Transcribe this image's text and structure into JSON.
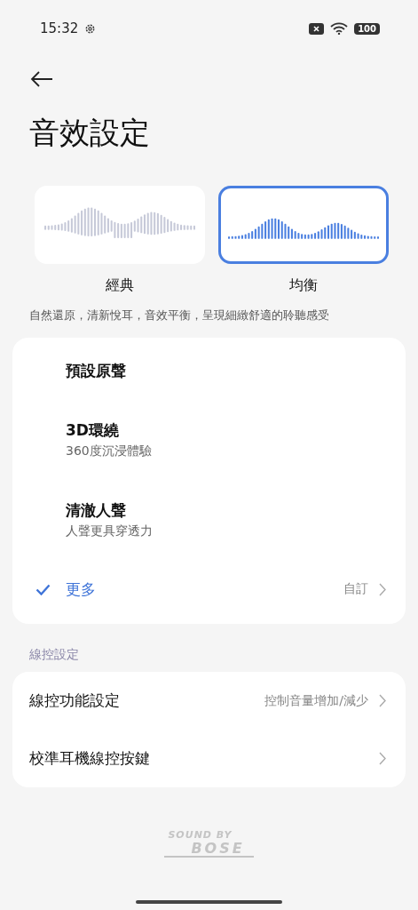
{
  "status_bar": {
    "time": "15:32",
    "battery": "100"
  },
  "page": {
    "title": "音效設定"
  },
  "presets": [
    {
      "label": "經典",
      "kind": "mirrored",
      "selected": false
    },
    {
      "label": "均衡",
      "kind": "rising",
      "selected": true
    }
  ],
  "preset_description": "自然還原，清新悅耳，音效平衡，呈現細緻舒適的聆聽感受",
  "sound_options": [
    {
      "title": "預設原聲",
      "selected": false,
      "arrow": false
    },
    {
      "title": "3D環繞",
      "subtitle": "360度沉浸體驗",
      "selected": false,
      "arrow": false
    },
    {
      "title": "清澈人聲",
      "subtitle": "人聲更具穿透力",
      "selected": false,
      "arrow": false
    },
    {
      "title": "更多",
      "value": "自訂",
      "selected": true,
      "arrow": true
    }
  ],
  "wire_control": {
    "header": "線控設定",
    "items": [
      {
        "title": "線控功能設定",
        "value": "控制音量增加/減少",
        "arrow": true
      },
      {
        "title": "校準耳機線控按鍵",
        "arrow": true
      }
    ]
  },
  "footer_logo": {
    "line_1": "SOUND BY",
    "line_2": "BOSE"
  }
}
